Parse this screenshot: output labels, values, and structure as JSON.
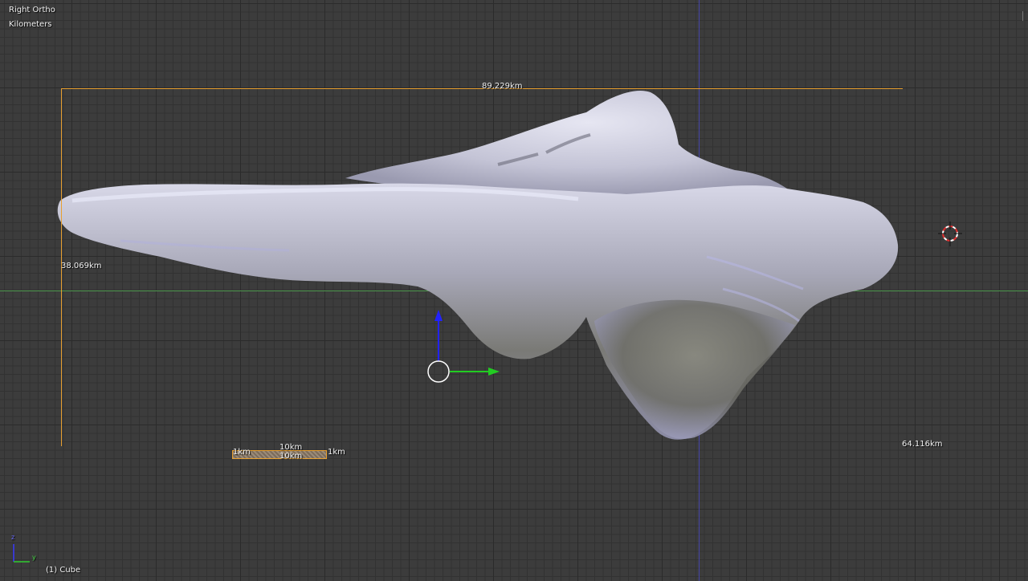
{
  "viewport": {
    "view_name": "Right Ortho",
    "units": "Kilometers",
    "object_label": "(1) Cube"
  },
  "dimensions": {
    "top_width": "89.229km",
    "left_height": "38.069km",
    "depth": "64.116km"
  },
  "scale_bar": {
    "left": "1km",
    "center_top": "10km",
    "center_bottom": "10km",
    "right": "1km"
  },
  "gizmo": {
    "z_color": "#2222ff",
    "y_color": "#22cc22",
    "axis_x_line_color": "#3f9b3f",
    "axis_z_line_color": "#3a3aa6",
    "dimension_color": "#e8a030"
  },
  "mini_axes": {
    "z_label": "z",
    "y_label": "y"
  }
}
